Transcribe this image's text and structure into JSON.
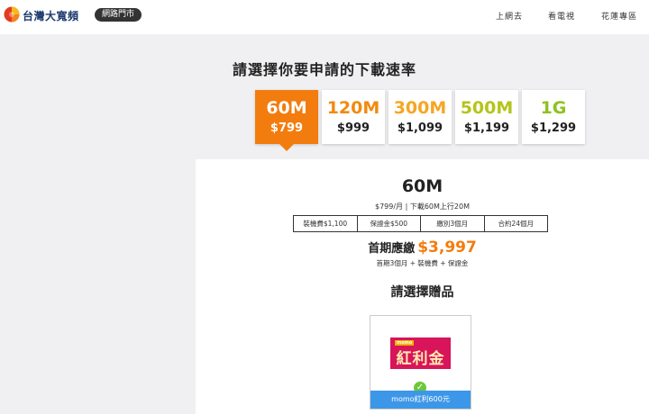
{
  "header": {
    "brand": "台灣大寬頻",
    "store_label": "網路門市",
    "nav": [
      "上網去",
      "看電視",
      "花蓮專區"
    ]
  },
  "page_title": "請選擇你要申請的下載速率",
  "speeds": [
    {
      "speed": "60M",
      "price": "$799",
      "color": "#ffffff"
    },
    {
      "speed": "120M",
      "price": "$999",
      "color": "#f28a0e"
    },
    {
      "speed": "300M",
      "price": "$1,099",
      "color": "#f5a623"
    },
    {
      "speed": "500M",
      "price": "$1,199",
      "color": "#b5c41a"
    },
    {
      "speed": "1G",
      "price": "$1,299",
      "color": "#8dc21f"
    }
  ],
  "selected_speed_index": 0,
  "plan": {
    "name": "60M",
    "desc": "$799/月 | 下載60M上行20M",
    "fees": [
      "裝機費$1,100",
      "保證金$500",
      "繳別3個月",
      "合約24個月"
    ],
    "first_pay_label": "首期應繳",
    "first_pay_amount": "$3,997",
    "first_pay_note": "首期3個月 + 裝機費 + 保證金"
  },
  "gift": {
    "title": "請選擇贈品",
    "brand_tag": "momo",
    "image_text": "紅利金",
    "label": "momo紅利600元",
    "check_symbol": "✓"
  },
  "colors": {
    "accent": "#f37c0e",
    "gift_label_bg": "#3d97e8",
    "check": "#6cc83b"
  }
}
